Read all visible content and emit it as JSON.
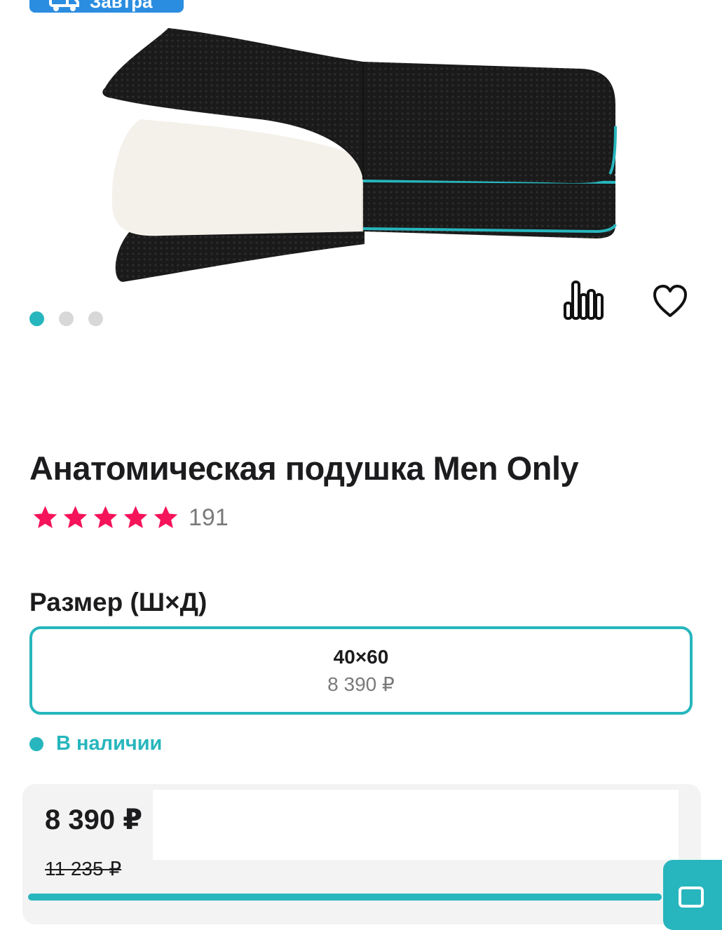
{
  "delivery": {
    "label": "Завтра"
  },
  "gallery": {
    "slide_count": 3,
    "active_slide": 1
  },
  "product": {
    "title": "Анатомическая подушка Men Only",
    "rating": 5,
    "reviews_count": "191"
  },
  "size": {
    "label": "Размер (Ш×Д)",
    "options": [
      {
        "dimensions": "40×60",
        "price": "8 390 ₽",
        "selected": true
      }
    ]
  },
  "availability": {
    "text": "В наличии"
  },
  "pricing": {
    "current": "8 390 ₽",
    "old": "11 235 ₽"
  },
  "colors": {
    "accent": "#27b6bd",
    "star": "#f5135a",
    "badge": "#2b8de0"
  }
}
